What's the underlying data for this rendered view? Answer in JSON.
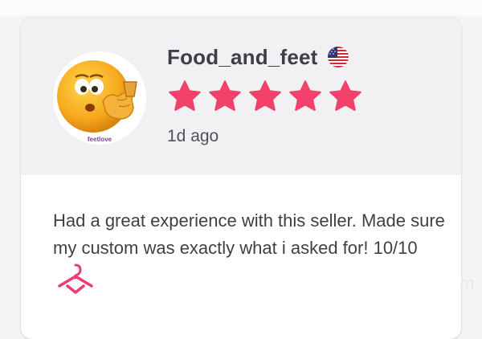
{
  "review": {
    "username": "Food_and_feet",
    "country_flag_icon": "us-flag-icon",
    "rating": 5,
    "rating_max": 5,
    "time_ago": "1d ago",
    "text": "Had a great experience with this seller. Made sure my custom was exactly what i asked for! 10/10",
    "avatar": {
      "icon": "emoji-avatar-icon",
      "brand_label": "feetlove"
    },
    "trailing_icon": "hanger-logo-icon"
  },
  "colors": {
    "star": "#f2426c",
    "accent": "#e83d77",
    "header_bg": "#f1f1f4",
    "text": "#3f3f46"
  }
}
